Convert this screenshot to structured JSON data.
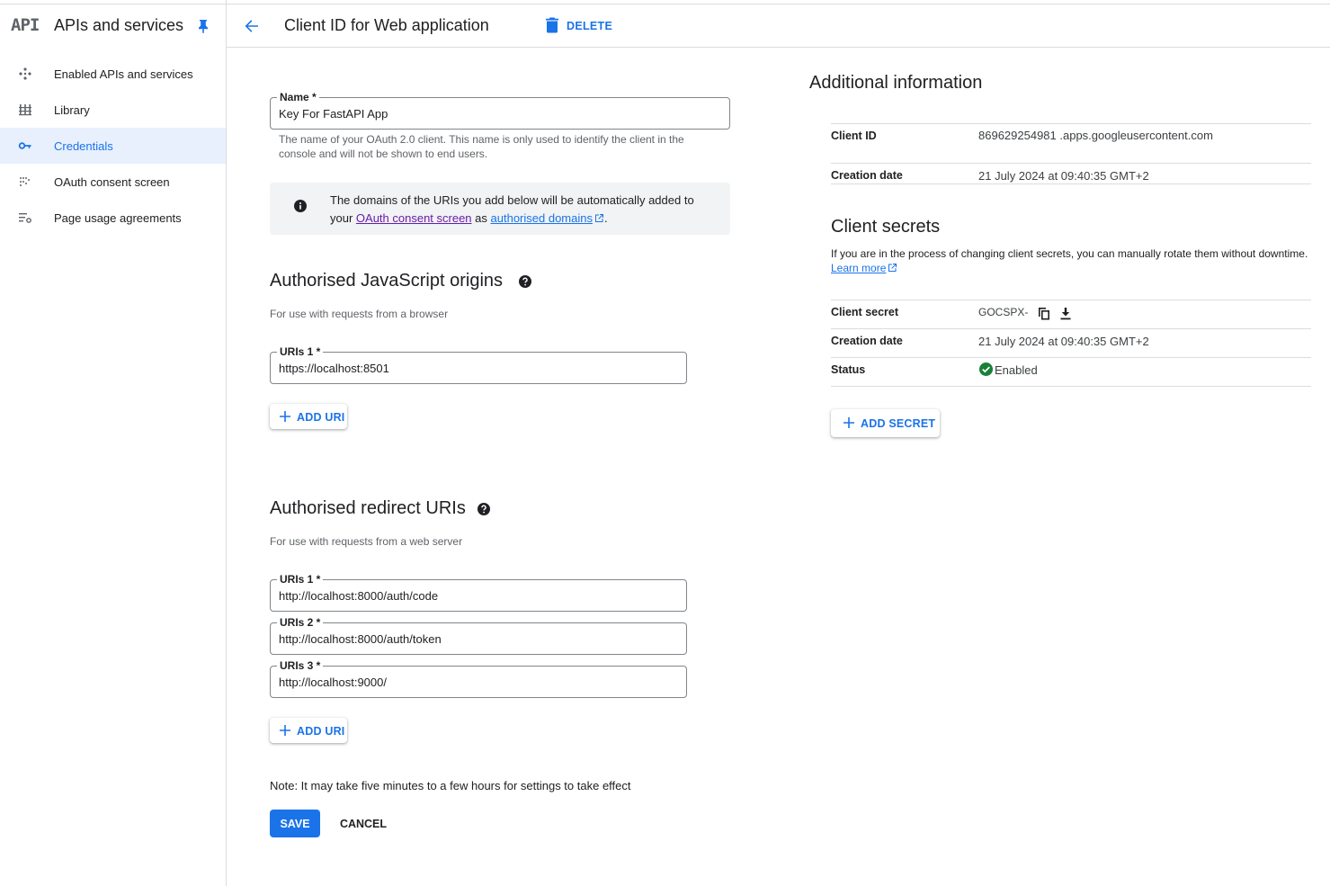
{
  "sidebar": {
    "logo": "API",
    "title": "APIs and services",
    "items": [
      {
        "label": "Enabled APIs and services"
      },
      {
        "label": "Library"
      },
      {
        "label": "Credentials"
      },
      {
        "label": "OAuth consent screen"
      },
      {
        "label": "Page usage agreements"
      }
    ],
    "active_item": "Credentials"
  },
  "header": {
    "title": "Client ID for Web application",
    "delete_label": "DELETE"
  },
  "form": {
    "name_label": "Name *",
    "name_value": "Key For FastAPI App",
    "name_helper": "The name of your OAuth 2.0 client. This name is only used to identify the client in the console and will not be shown to end users.",
    "info": {
      "text_before": "The domains of the URIs you add below will be automatically added to your ",
      "link1": "OAuth consent screen",
      "text_mid": " as ",
      "link2": "authorised domains",
      "text_after": "."
    },
    "js_origins": {
      "title": "Authorised JavaScript origins",
      "subtitle": "For use with requests from a browser",
      "uris": [
        {
          "label": "URIs 1 *",
          "value": "https://localhost:8501"
        }
      ],
      "add_label": "ADD URI"
    },
    "redirects": {
      "title": "Authorised redirect URIs",
      "subtitle": "For use with requests from a web server",
      "uris": [
        {
          "label": "URIs 1 *",
          "value": "http://localhost:8000/auth/code"
        },
        {
          "label": "URIs 2 *",
          "value": "http://localhost:8000/auth/token"
        },
        {
          "label": "URIs 3 *",
          "value": "http://localhost:9000/"
        }
      ],
      "add_label": "ADD URI"
    },
    "note": "Note: It may take five minutes to a few hours for settings to take effect",
    "save_label": "SAVE",
    "cancel_label": "CANCEL"
  },
  "additional": {
    "title": "Additional information",
    "client_id_key": "Client ID",
    "client_id_value": "869629254981 .apps.googleusercontent.com",
    "creation_key": "Creation date",
    "creation_value": "21 July 2024 at 09:40:35 GMT+2"
  },
  "secrets": {
    "title": "Client secrets",
    "description": "If you are in the process of changing client secrets, you can manually rotate them without downtime.",
    "learn_more": "Learn more",
    "secret_key": "Client secret",
    "secret_value": "GOCSPX-",
    "creation_key": "Creation date",
    "creation_value": "21 July 2024 at 09:40:35 GMT+2",
    "status_key": "Status",
    "status_value": "Enabled",
    "add_label": "ADD SECRET"
  },
  "colors": {
    "accent": "#1a73e8",
    "active_bg": "#e8f0fe",
    "enabled_green": "#188038",
    "visited_link": "#681da8"
  },
  "icons": [
    "pin-icon",
    "back-arrow-icon",
    "trash-icon",
    "enabled-apis-icon",
    "library-icon",
    "key-icon",
    "consent-screen-icon",
    "page-usage-icon",
    "info-icon",
    "help-icon",
    "plus-icon",
    "external-link-icon",
    "copy-icon",
    "download-icon",
    "check-circle-icon"
  ]
}
